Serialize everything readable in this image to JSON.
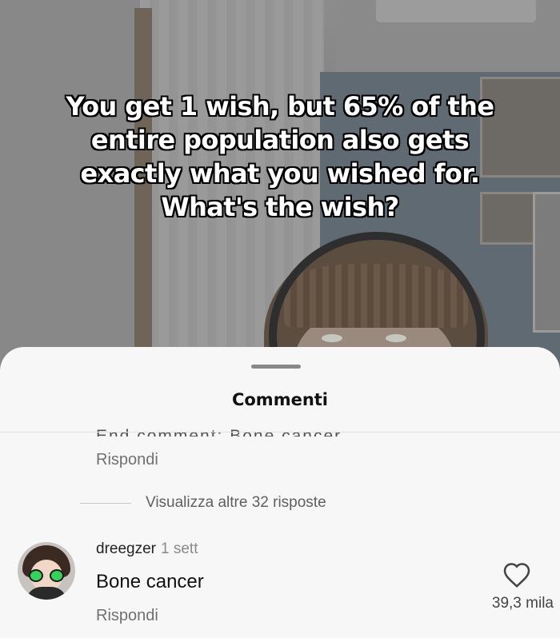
{
  "video": {
    "caption_lines": [
      "You get 1 wish, but 65% of the",
      "entire population also gets",
      "exactly what you wished for.",
      "What's the wish?"
    ]
  },
  "comments_sheet": {
    "title": "Commenti",
    "partial_comment": {
      "text_cut": "End comment: Bone cancer",
      "reply_label": "Rispondi"
    },
    "view_more_replies": "Visualizza altre 32 risposte",
    "comment": {
      "username": "dreegzer",
      "time": "1 sett",
      "text": "Bone cancer",
      "reply_label": "Rispondi",
      "like_count": "39,3 mila"
    }
  },
  "colors": {
    "sheet_bg": "#f7f7f7",
    "caption_text": "#ffffff",
    "caption_outline": "#000000"
  }
}
